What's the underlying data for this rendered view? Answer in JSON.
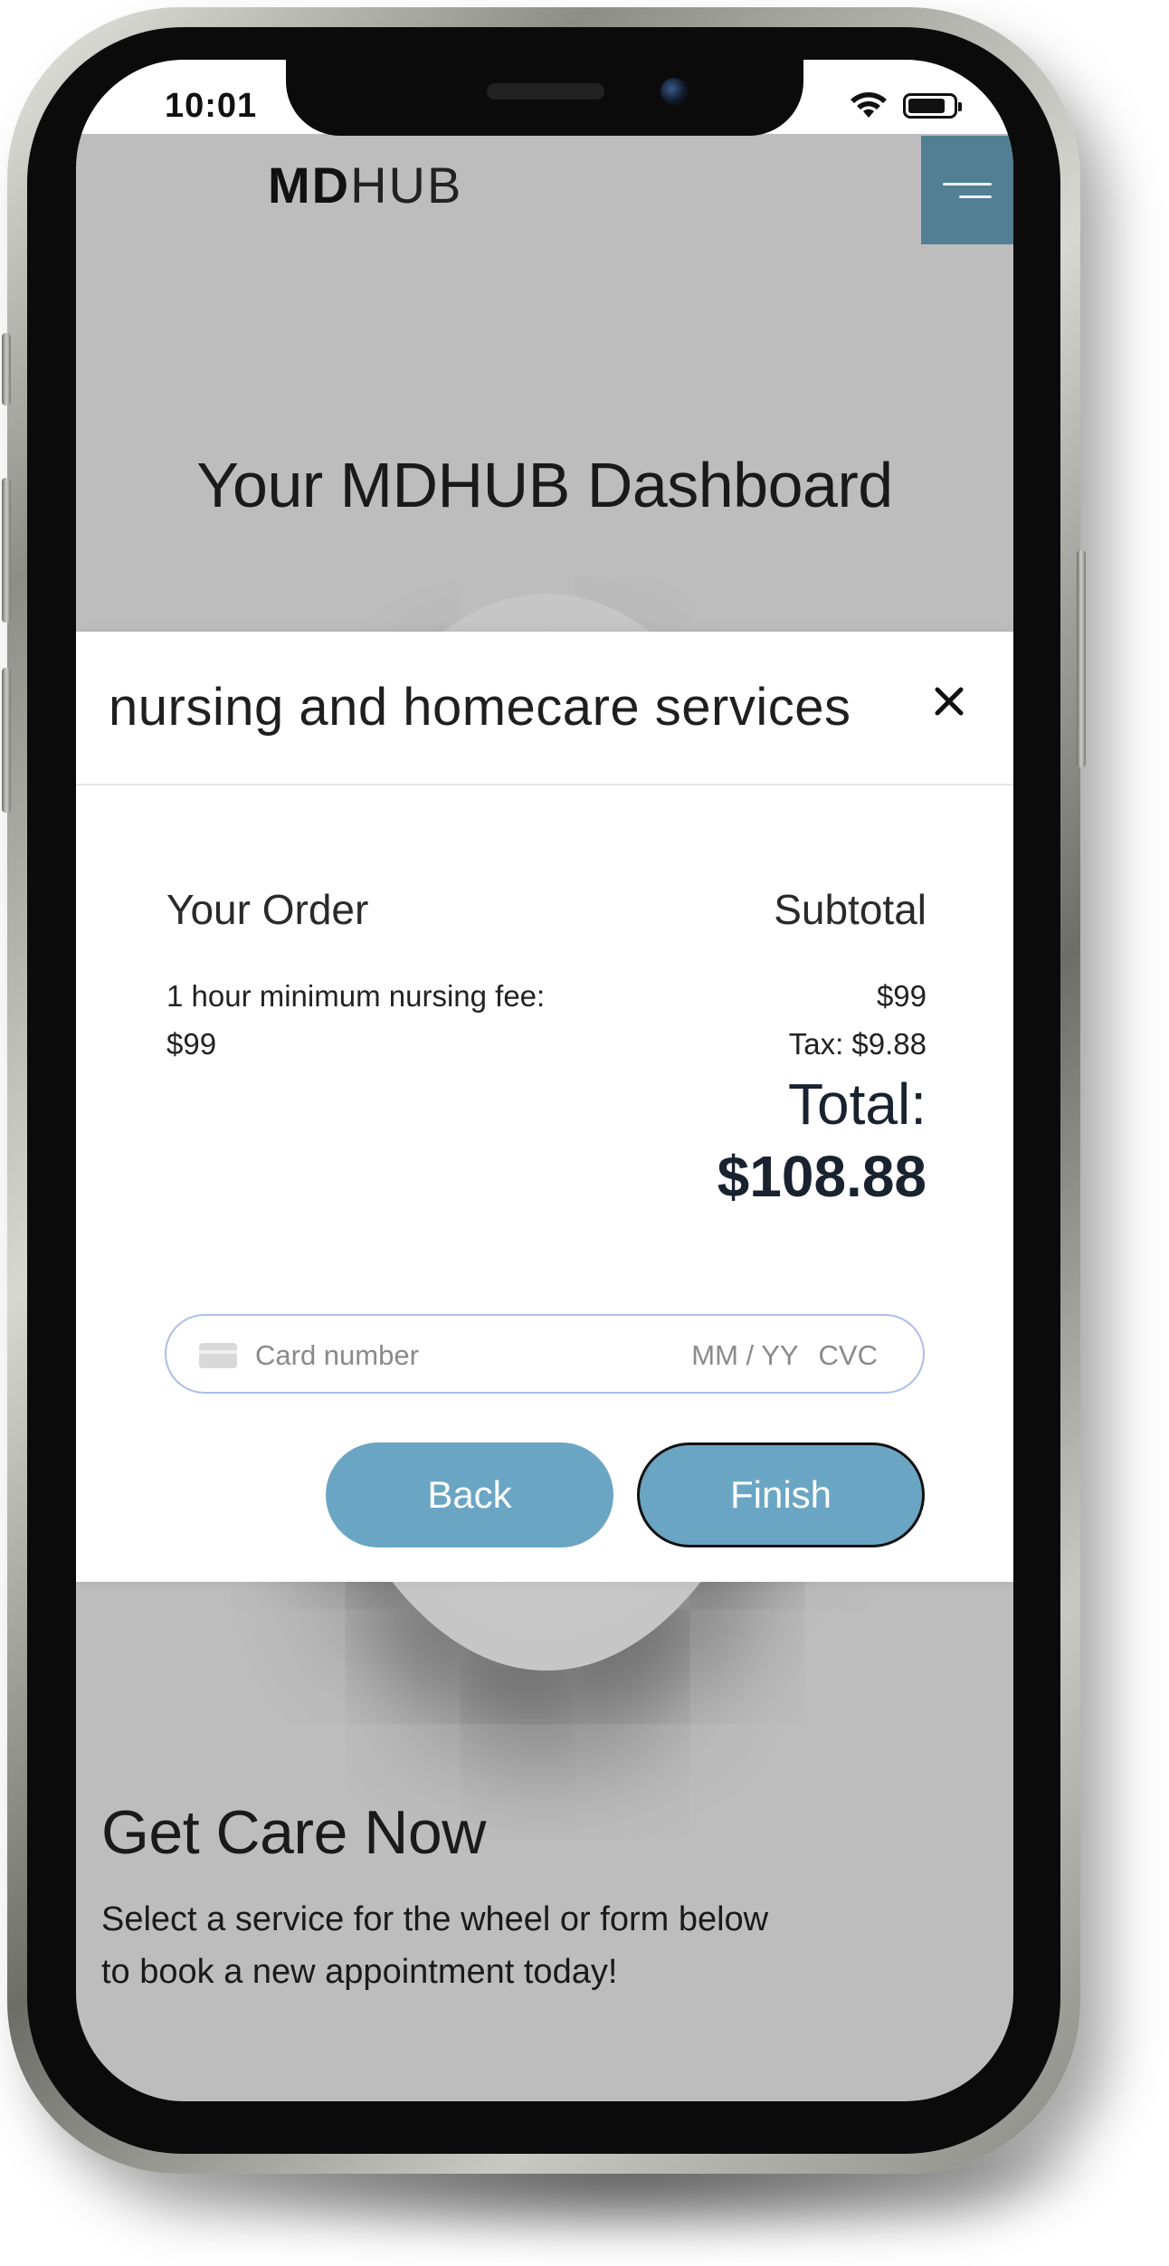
{
  "status_bar": {
    "time": "10:01"
  },
  "header": {
    "logo_bold": "MD",
    "logo_light": "HUB",
    "menu_icon": "hamburger-menu-icon",
    "menu_color": "#527f93"
  },
  "dashboard": {
    "title": "Your MDHUB Dashboard"
  },
  "modal": {
    "title": "nursing and homecare services",
    "close_icon": "close-icon",
    "order_label": "Your Order",
    "subtotal_label": "Subtotal",
    "line_item": "1 hour minimum nursing fee: $99",
    "subtotal_value": "$99",
    "tax": "Tax: $9.88",
    "total_label": "Total:",
    "total_value": "$108.88",
    "card": {
      "placeholder": "Card number",
      "expiry_placeholder": "MM / YY",
      "cvc_placeholder": "CVC",
      "icon": "credit-card-icon"
    },
    "back_label": "Back",
    "finish_label": "Finish",
    "button_color": "#6aa6c4"
  },
  "care_section": {
    "title": "Get Care Now",
    "text": "Select a service for the wheel or form below to book a new appointment today!"
  }
}
